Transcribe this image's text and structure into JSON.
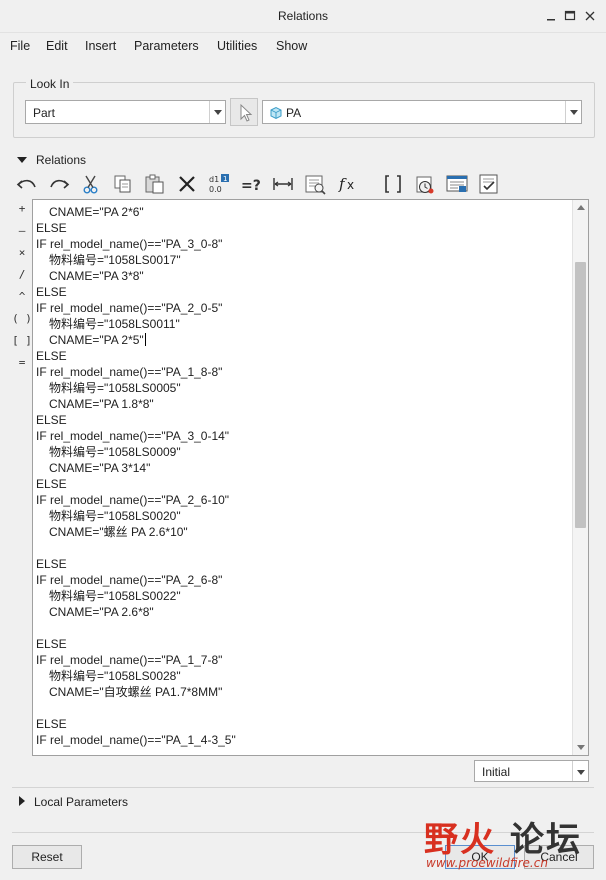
{
  "window": {
    "title": "Relations"
  },
  "menu": [
    "File",
    "Edit",
    "Insert",
    "Parameters",
    "Utilities",
    "Show"
  ],
  "look_in": {
    "legend": "Look In",
    "type_value": "Part",
    "model_value": "PA"
  },
  "relations_section": {
    "label": "Relations"
  },
  "toolbar_icons": [
    "undo-icon",
    "redo-icon",
    "cut-icon",
    "copy-icon",
    "paste-icon",
    "delete-icon",
    "switch-dimensions-icon",
    "evaluate-icon",
    "insert-dimension-icon",
    "parameter-icon",
    "function-icon",
    "brackets-icon",
    "sort-icon",
    "execute-icon",
    "verify-icon"
  ],
  "operators": [
    "+",
    "–",
    "×",
    "/",
    "^",
    "( )",
    "[ ]",
    "="
  ],
  "editor": {
    "lines": [
      {
        "text": "CNAME=\"PA 2*6\"",
        "indent": true
      },
      {
        "text": "ELSE",
        "indent": false
      },
      {
        "text": "IF rel_model_name()==\"PA_3_0-8\"",
        "indent": false
      },
      {
        "text": "物料编号=\"1058LS0017\"",
        "indent": true
      },
      {
        "text": "CNAME=\"PA 3*8\"",
        "indent": true
      },
      {
        "text": "ELSE",
        "indent": false
      },
      {
        "text": "IF rel_model_name()==\"PA_2_0-5\"",
        "indent": false
      },
      {
        "text": "物料编号=\"1058LS0011\"",
        "indent": true
      },
      {
        "text": "CNAME=\"PA 2*5\"",
        "indent": true,
        "caret": true
      },
      {
        "text": "ELSE",
        "indent": false
      },
      {
        "text": "IF rel_model_name()==\"PA_1_8-8\"",
        "indent": false
      },
      {
        "text": "物料编号=\"1058LS0005\"",
        "indent": true
      },
      {
        "text": "CNAME=\"PA 1.8*8\"",
        "indent": true
      },
      {
        "text": "ELSE",
        "indent": false
      },
      {
        "text": "IF rel_model_name()==\"PA_3_0-14\"",
        "indent": false
      },
      {
        "text": "物料编号=\"1058LS0009\"",
        "indent": true
      },
      {
        "text": "CNAME=\"PA 3*14\"",
        "indent": true
      },
      {
        "text": "ELSE",
        "indent": false
      },
      {
        "text": "IF rel_model_name()==\"PA_2_6-10\"",
        "indent": false
      },
      {
        "text": "物料编号=\"1058LS0020\"",
        "indent": true
      },
      {
        "text": "CNAME=\"螺丝 PA 2.6*10\"",
        "indent": true
      },
      {
        "text": "",
        "indent": false
      },
      {
        "text": "ELSE",
        "indent": false
      },
      {
        "text": "IF rel_model_name()==\"PA_2_6-8\"",
        "indent": false
      },
      {
        "text": "物料编号=\"1058LS0022\"",
        "indent": true
      },
      {
        "text": "CNAME=\"PA 2.6*8\"",
        "indent": true
      },
      {
        "text": "",
        "indent": false
      },
      {
        "text": "ELSE",
        "indent": false
      },
      {
        "text": "IF rel_model_name()==\"PA_1_7-8\"",
        "indent": false
      },
      {
        "text": "物料编号=\"1058LS0028\"",
        "indent": true
      },
      {
        "text": "CNAME=\"自攻螺丝 PA1.7*8MM\"",
        "indent": true
      },
      {
        "text": "",
        "indent": false
      },
      {
        "text": "ELSE",
        "indent": false
      },
      {
        "text": "IF rel_model_name()==\"PA_1_4-3_5\"",
        "indent": false
      }
    ]
  },
  "units_dropdown": {
    "value": "Initial"
  },
  "local_parameters": {
    "label": "Local Parameters"
  },
  "buttons": {
    "reset": "Reset",
    "ok": "OK",
    "cancel": "Cancel"
  },
  "watermark": {
    "text1": "野火",
    "text2": "论坛",
    "url": "www.proewildfire.cn"
  }
}
